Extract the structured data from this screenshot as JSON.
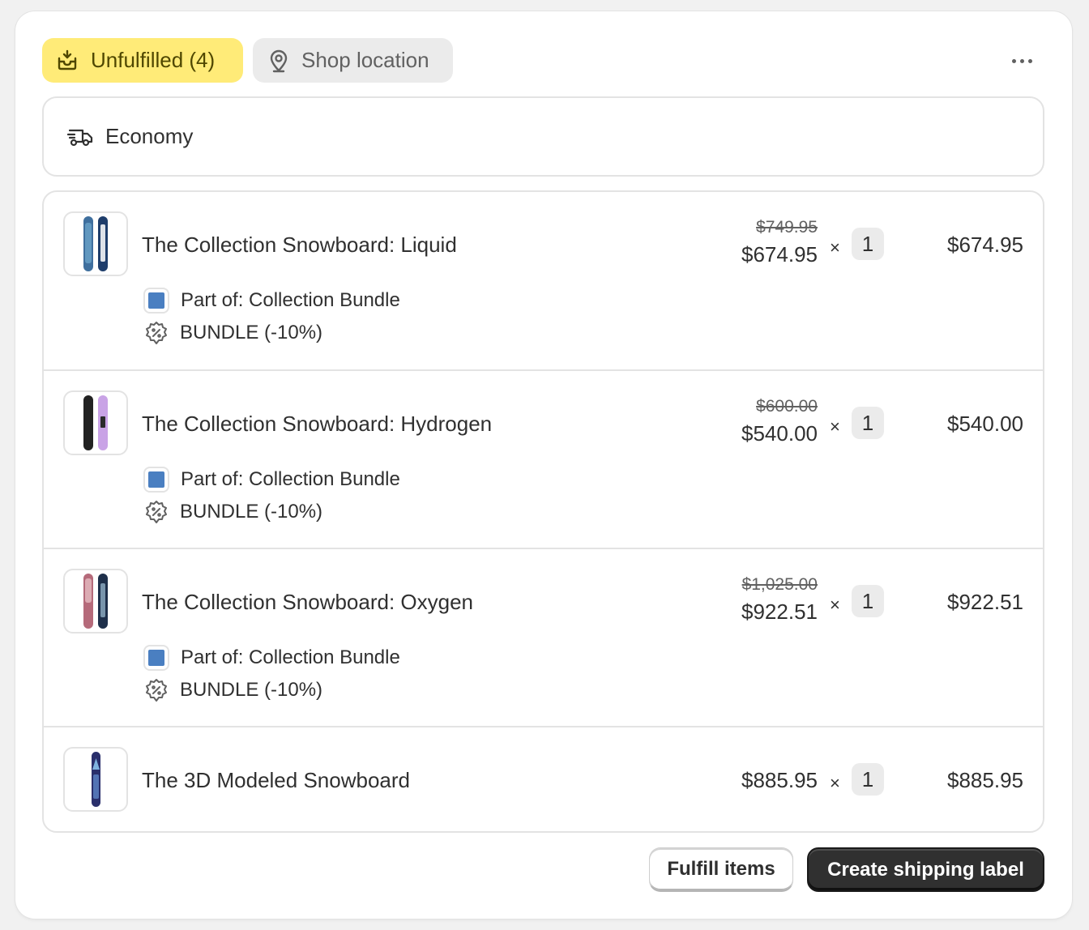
{
  "header": {
    "status_badge": "Unfulfilled (4)",
    "location_badge": "Shop location",
    "more_actions_icon": "ellipsis-horizontal-icon"
  },
  "shipping": {
    "icon": "truck-icon",
    "method": "Economy"
  },
  "line_items": [
    {
      "title": "The Collection Snowboard: Liquid",
      "part_of": "Part of: Collection Bundle",
      "discount": "BUNDLE (-10%)",
      "original_price": "$749.95",
      "price": "$674.95",
      "multiply": "×",
      "quantity": "1",
      "total": "$674.95",
      "colors": [
        "#3f6f9e",
        "#1e3d6b"
      ]
    },
    {
      "title": "The Collection Snowboard: Hydrogen",
      "part_of": "Part of: Collection Bundle",
      "discount": "BUNDLE (-10%)",
      "original_price": "$600.00",
      "price": "$540.00",
      "multiply": "×",
      "quantity": "1",
      "total": "$540.00",
      "colors": [
        "#222222",
        "#c9a3e6"
      ]
    },
    {
      "title": "The Collection Snowboard: Oxygen",
      "part_of": "Part of: Collection Bundle",
      "discount": "BUNDLE (-10%)",
      "original_price": "$1,025.00",
      "price": "$922.51",
      "multiply": "×",
      "quantity": "1",
      "total": "$922.51",
      "colors": [
        "#b56a7a",
        "#1e2f4a"
      ]
    },
    {
      "title": "The 3D Modeled Snowboard",
      "price": "$885.95",
      "multiply": "×",
      "quantity": "1",
      "total": "$885.95",
      "colors": [
        "#2a2f6b"
      ]
    }
  ],
  "actions": {
    "fulfill": "Fulfill items",
    "create_label": "Create shipping label"
  },
  "colors": {
    "status_badge_bg": "#ffeb78",
    "primary_button_bg": "#303030",
    "bundle_swatch": "#4a7fc1"
  }
}
